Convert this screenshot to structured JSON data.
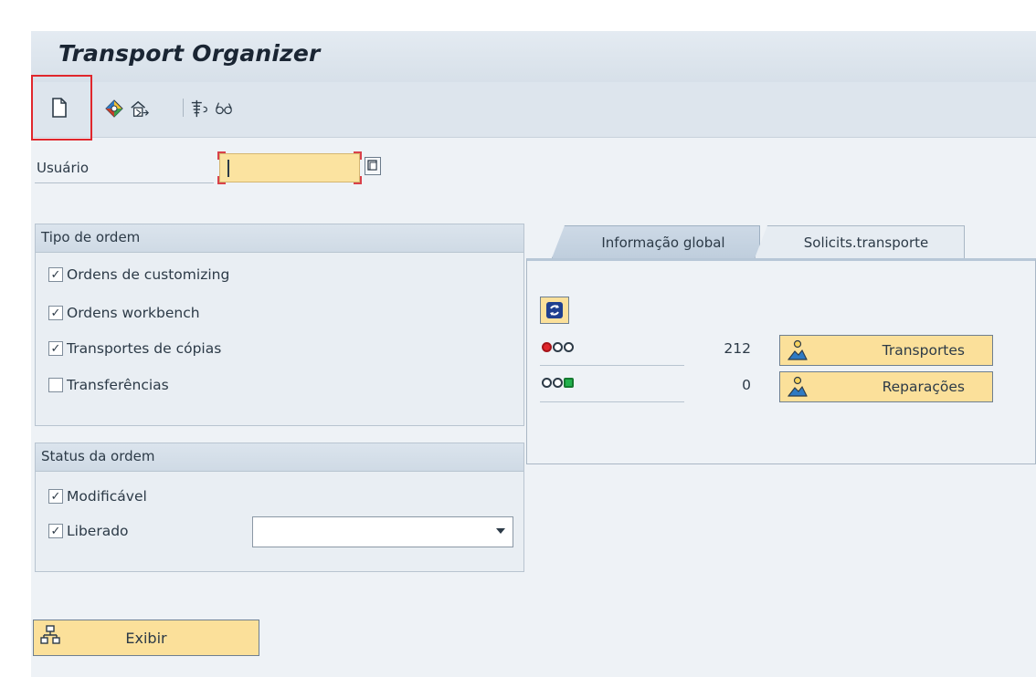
{
  "window": {
    "title": "Transport Organizer"
  },
  "toolbar": {
    "items": [
      {
        "name": "new-document-icon"
      },
      {
        "name": "change-icon"
      },
      {
        "name": "release-icon"
      },
      {
        "name": "transport-tools-icon"
      },
      {
        "name": "glasses-display-icon"
      }
    ],
    "highlight_color": "#e0262c"
  },
  "user_field": {
    "label": "Usuário",
    "value": ""
  },
  "order_type": {
    "title": "Tipo de ordem",
    "options": [
      {
        "label": "Ordens de customizing",
        "checked": true
      },
      {
        "label": "Ordens workbench",
        "checked": true
      },
      {
        "label": "Transportes de cópias",
        "checked": true
      },
      {
        "label": "Transferências",
        "checked": false
      }
    ]
  },
  "order_status": {
    "title": "Status da ordem",
    "options": [
      {
        "label": "Modificável",
        "checked": true
      },
      {
        "label": "Liberado",
        "checked": true
      }
    ],
    "released_dropdown_value": ""
  },
  "tabs": [
    {
      "label": "Informação global",
      "active": true
    },
    {
      "label": "Solicits.transporte",
      "active": false
    }
  ],
  "global_info": {
    "rows": [
      {
        "status": "red",
        "count": "212",
        "button_label": "Transportes"
      },
      {
        "status": "green",
        "count": "0",
        "button_label": "Reparações"
      }
    ]
  },
  "display_button": {
    "label": "Exibir"
  },
  "colors": {
    "button_yellow": "#fbe09a",
    "input_yellow": "#fbe3a0",
    "red": "#e0262c",
    "green": "#22b14c"
  }
}
